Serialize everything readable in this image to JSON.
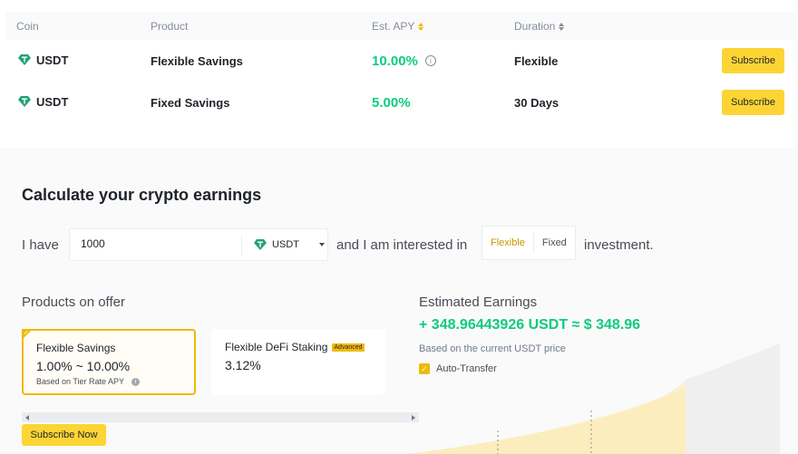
{
  "table": {
    "headers": {
      "coin": "Coin",
      "product": "Product",
      "apy": "Est. APY",
      "duration": "Duration"
    },
    "rows": [
      {
        "coin": "USDT",
        "product": "Flexible Savings",
        "apy": "10.00%",
        "duration": "Flexible",
        "action": "Subscribe"
      },
      {
        "coin": "USDT",
        "product": "Fixed Savings",
        "apy": "5.00%",
        "duration": "30 Days",
        "action": "Subscribe"
      }
    ]
  },
  "calculator": {
    "title": "Calculate your crypto earnings",
    "i_have": "I have",
    "amount": "1000",
    "coin": "USDT",
    "interested": "and I am interested in",
    "toggle": {
      "flexible": "Flexible",
      "fixed": "Fixed"
    },
    "investment": "investment.",
    "products_title": "Products on offer",
    "products": [
      {
        "name": "Flexible Savings",
        "rate": "1.00% ~ 10.00%",
        "note": "Based on Tier Rate APY"
      },
      {
        "name": "Flexible DeFi Staking",
        "badge": "Advanced",
        "rate": "3.12%"
      }
    ],
    "subscribe_now": "Subscribe Now",
    "estimated_title": "Estimated Earnings",
    "estimated_value": "+ 348.96443926 USDT ≈ $ 348.96",
    "estimated_note": "Based on the current USDT price",
    "auto_transfer": "Auto-Transfer"
  },
  "colors": {
    "accent": "#f0b90b",
    "button": "#fcd535",
    "positive": "#0ecb81",
    "tether": "#26a17b"
  }
}
